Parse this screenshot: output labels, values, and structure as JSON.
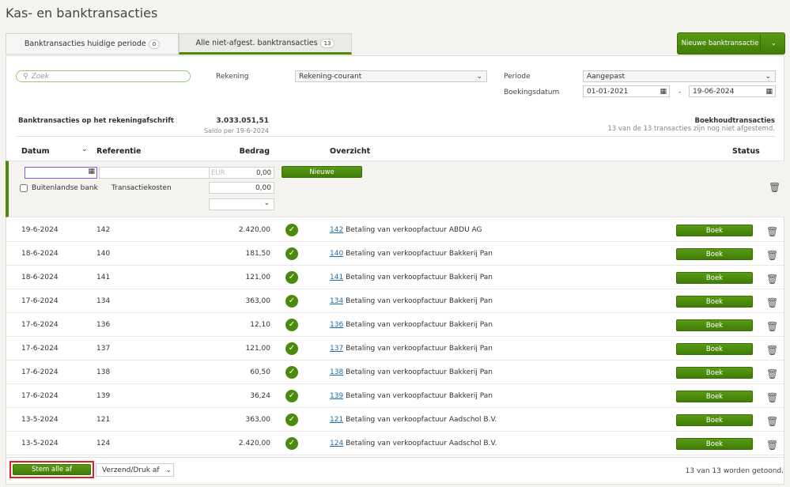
{
  "title": "Kas- en banktransacties",
  "tabs": [
    {
      "label": "Banktransacties huidige periode",
      "count": "0"
    },
    {
      "label": "Alle niet-afgest. banktransacties",
      "count": "13"
    }
  ],
  "new_button": "Nieuwe banktransactie",
  "search": {
    "placeholder": "Zoek"
  },
  "filters": {
    "rekening_label": "Rekening",
    "rekening_value": "Rekening-courant",
    "periode_label": "Periode",
    "periode_value": "Aangepast",
    "boekingsdatum_label": "Boekingsdatum",
    "date_from": "01-01-2021",
    "date_sep": "-",
    "date_to": "19-06-2024"
  },
  "summary": {
    "left_title": "Banktransacties op het rekeningafschrift",
    "balance": "3.033.051,51",
    "balance_sub": "Saldo per 19-6-2024",
    "right_title": "Boekhoudtransacties",
    "right_sub": "13 van de 13 transacties zijn nog niet afgestemd."
  },
  "columns": {
    "datum": "Datum",
    "referentie": "Referentie",
    "bedrag": "Bedrag",
    "overzicht": "Overzicht",
    "status": "Status"
  },
  "new_row": {
    "currency": "EUR",
    "amount": "0,00",
    "foreign_bank": "Buitenlandse bank",
    "costs_label": "Transactiekosten",
    "costs": "0,00",
    "new_btn": "Nieuwe"
  },
  "rows": [
    {
      "date": "19-6-2024",
      "ref": "142",
      "amount": "2.420,00",
      "link": "142",
      "desc": "Betaling van verkoopfactuur ABDU AG"
    },
    {
      "date": "18-6-2024",
      "ref": "140",
      "amount": "181,50",
      "link": "140",
      "desc": "Betaling van verkoopfactuur Bakkerij Pan"
    },
    {
      "date": "18-6-2024",
      "ref": "141",
      "amount": "121,00",
      "link": "141",
      "desc": "Betaling van verkoopfactuur Bakkerij Pan"
    },
    {
      "date": "17-6-2024",
      "ref": "134",
      "amount": "363,00",
      "link": "134",
      "desc": "Betaling van verkoopfactuur Bakkerij Pan"
    },
    {
      "date": "17-6-2024",
      "ref": "136",
      "amount": "12,10",
      "link": "136",
      "desc": "Betaling van verkoopfactuur Bakkerij Pan"
    },
    {
      "date": "17-6-2024",
      "ref": "137",
      "amount": "121,00",
      "link": "137",
      "desc": "Betaling van verkoopfactuur Bakkerij Pan"
    },
    {
      "date": "17-6-2024",
      "ref": "138",
      "amount": "60,50",
      "link": "138",
      "desc": "Betaling van verkoopfactuur Bakkerij Pan"
    },
    {
      "date": "17-6-2024",
      "ref": "139",
      "amount": "36,24",
      "link": "139",
      "desc": "Betaling van verkoopfactuur Bakkerij Pan"
    },
    {
      "date": "13-5-2024",
      "ref": "121",
      "amount": "363,00",
      "link": "121",
      "desc": "Betaling van verkoopfactuur Aadschol B.V."
    },
    {
      "date": "13-5-2024",
      "ref": "124",
      "amount": "2.420,00",
      "link": "124",
      "desc": "Betaling van verkoopfactuur Aadschol B.V."
    }
  ],
  "boek_label": "Boek",
  "footer": {
    "reconcile_all": "Stem alle af",
    "send_print": "Verzend/Druk af",
    "count_text": "13 van 13 worden getoond."
  },
  "colors": {
    "accent": "#4a8a0d",
    "highlight": "#e02020"
  }
}
